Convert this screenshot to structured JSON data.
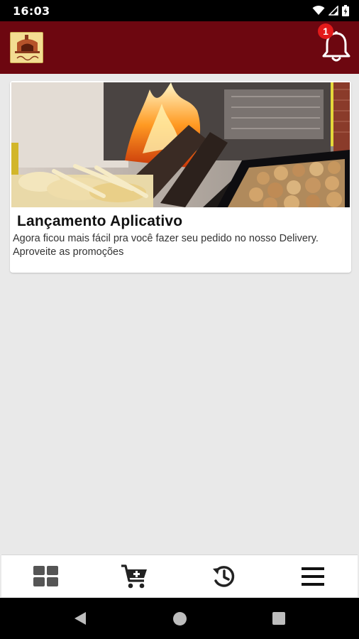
{
  "status_bar": {
    "time": "16:03"
  },
  "app_bar": {
    "logo_icon": "restaurant-logo",
    "notification_icon": "bell-icon",
    "notification_count": "1",
    "background_color": "#6d0710"
  },
  "feed": {
    "items": [
      {
        "image": "wood-fired-oven-with-food-photo",
        "title": "Lançamento Aplicativo",
        "description": "Agora ficou mais fácil pra você fazer seu pedido no nosso Delivery. Aproveite as promoções"
      }
    ]
  },
  "bottom_nav": {
    "items": [
      {
        "icon": "grid-icon"
      },
      {
        "icon": "add-to-cart-icon"
      },
      {
        "icon": "history-icon"
      },
      {
        "icon": "menu-icon"
      }
    ]
  }
}
